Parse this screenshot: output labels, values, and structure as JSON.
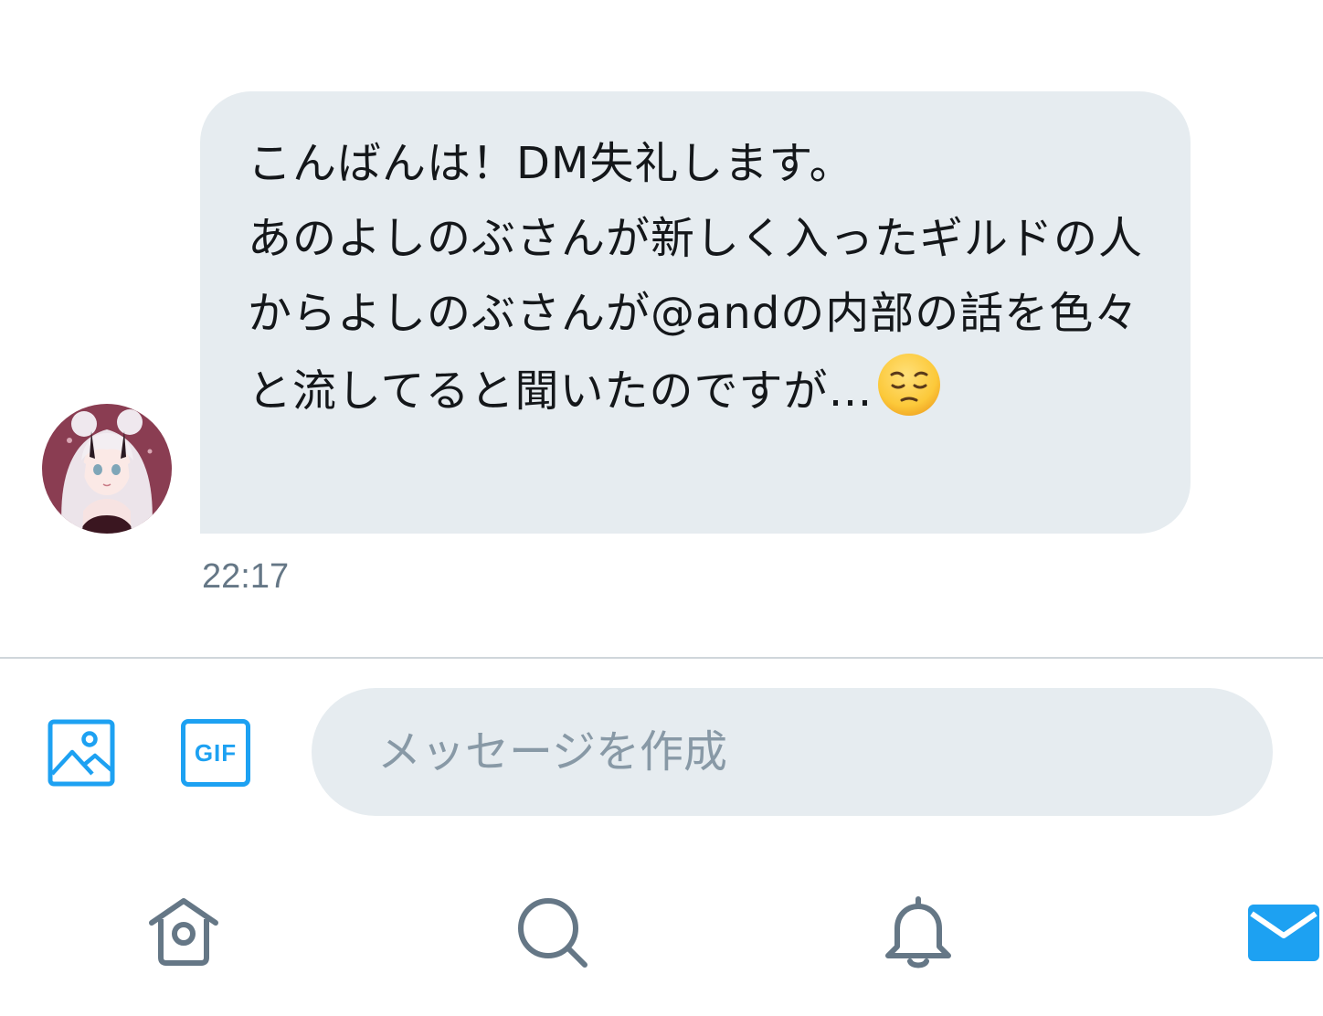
{
  "conversation": {
    "message": {
      "text": "こんばんは！DM失礼します。\nあのよしのぶさんが新しく入ったギルドの人からよしのぶさんが@andの内部の話を色々と流してると聞いたのですが…",
      "emoji": "pensive-face",
      "timestamp": "22:17"
    },
    "avatar": {
      "description": "sender-avatar"
    }
  },
  "composer": {
    "placeholder": "メッセージを作成",
    "value": "",
    "gif_label": "GIF",
    "media_icon": "image-icon"
  },
  "tabbar": {
    "tabs": [
      {
        "icon": "home-icon",
        "active": false
      },
      {
        "icon": "search-icon",
        "active": false
      },
      {
        "icon": "bell-icon",
        "active": false
      },
      {
        "icon": "mail-icon",
        "active": true
      }
    ]
  },
  "colors": {
    "accent": "#1da1f2",
    "bubble": "#e6ecf0",
    "icon_inactive": "#657786",
    "text": "#14171a",
    "timestamp": "#657786",
    "placeholder": "#8899a6"
  }
}
